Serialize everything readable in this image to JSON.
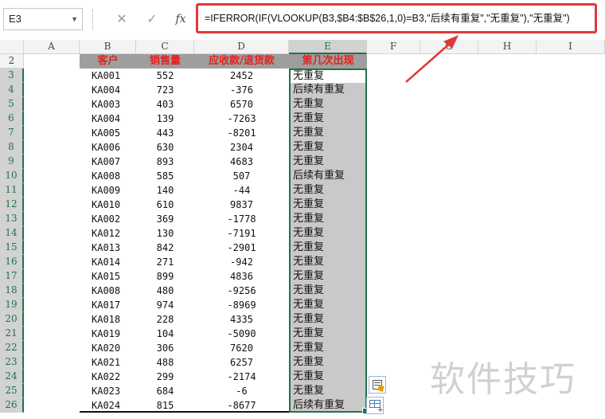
{
  "formula_bar": {
    "name_box": "E3",
    "cancel_glyph": "✕",
    "enter_glyph": "✓",
    "fx_label": "fx",
    "formula": "=IFERROR(IF(VLOOKUP(B3,$B4:$B$26,1,0)=B3,\"后续有重复\",\"无重复\"),\"无重复\")",
    "highlight_color": "#e0393c"
  },
  "columns": [
    "A",
    "B",
    "C",
    "D",
    "E",
    "F",
    "G",
    "H",
    "I"
  ],
  "selected_column": "E",
  "header_row": {
    "row_number": "2",
    "customer": "客户",
    "sales": "销售量",
    "amount": "应收款/退货款",
    "occurrence": "第几次出现"
  },
  "rows": [
    {
      "row": "3",
      "customer": "KA001",
      "sales": "552",
      "amount": "2452",
      "result": "无重复"
    },
    {
      "row": "4",
      "customer": "KA004",
      "sales": "723",
      "amount": "-376",
      "result": "后续有重复"
    },
    {
      "row": "5",
      "customer": "KA003",
      "sales": "403",
      "amount": "6570",
      "result": "无重复"
    },
    {
      "row": "6",
      "customer": "KA004",
      "sales": "139",
      "amount": "-7263",
      "result": "无重复"
    },
    {
      "row": "7",
      "customer": "KA005",
      "sales": "443",
      "amount": "-8201",
      "result": "无重复"
    },
    {
      "row": "8",
      "customer": "KA006",
      "sales": "630",
      "amount": "2304",
      "result": "无重复"
    },
    {
      "row": "9",
      "customer": "KA007",
      "sales": "893",
      "amount": "4683",
      "result": "无重复"
    },
    {
      "row": "10",
      "customer": "KA008",
      "sales": "585",
      "amount": "507",
      "result": "后续有重复"
    },
    {
      "row": "11",
      "customer": "KA009",
      "sales": "140",
      "amount": "-44",
      "result": "无重复"
    },
    {
      "row": "12",
      "customer": "KA010",
      "sales": "610",
      "amount": "9837",
      "result": "无重复"
    },
    {
      "row": "13",
      "customer": "KA002",
      "sales": "369",
      "amount": "-1778",
      "result": "无重复"
    },
    {
      "row": "14",
      "customer": "KA012",
      "sales": "130",
      "amount": "-7191",
      "result": "无重复"
    },
    {
      "row": "15",
      "customer": "KA013",
      "sales": "842",
      "amount": "-2901",
      "result": "无重复"
    },
    {
      "row": "16",
      "customer": "KA014",
      "sales": "271",
      "amount": "-942",
      "result": "无重复"
    },
    {
      "row": "17",
      "customer": "KA015",
      "sales": "899",
      "amount": "4836",
      "result": "无重复"
    },
    {
      "row": "18",
      "customer": "KA008",
      "sales": "480",
      "amount": "-9256",
      "result": "无重复"
    },
    {
      "row": "19",
      "customer": "KA017",
      "sales": "974",
      "amount": "-8969",
      "result": "无重复"
    },
    {
      "row": "20",
      "customer": "KA018",
      "sales": "228",
      "amount": "4335",
      "result": "无重复"
    },
    {
      "row": "21",
      "customer": "KA019",
      "sales": "104",
      "amount": "-5090",
      "result": "无重复"
    },
    {
      "row": "22",
      "customer": "KA020",
      "sales": "306",
      "amount": "7620",
      "result": "无重复"
    },
    {
      "row": "23",
      "customer": "KA021",
      "sales": "488",
      "amount": "6257",
      "result": "无重复"
    },
    {
      "row": "24",
      "customer": "KA022",
      "sales": "299",
      "amount": "-2174",
      "result": "无重复"
    },
    {
      "row": "25",
      "customer": "KA023",
      "sales": "684",
      "amount": "-6",
      "result": "无重复"
    },
    {
      "row": "26",
      "customer": "KA024",
      "sales": "815",
      "amount": "-8677",
      "result": "后续有重复"
    }
  ],
  "watermark": "软件技巧",
  "colors": {
    "accent_green": "#217346",
    "header_text_red": "#e8201c",
    "header_fill": "#9e9e9e",
    "selection_fill": "#c9c9c9"
  },
  "icons": {
    "flash_fill": "flash-fill-icon",
    "quick_analysis": "quick-analysis-icon"
  }
}
